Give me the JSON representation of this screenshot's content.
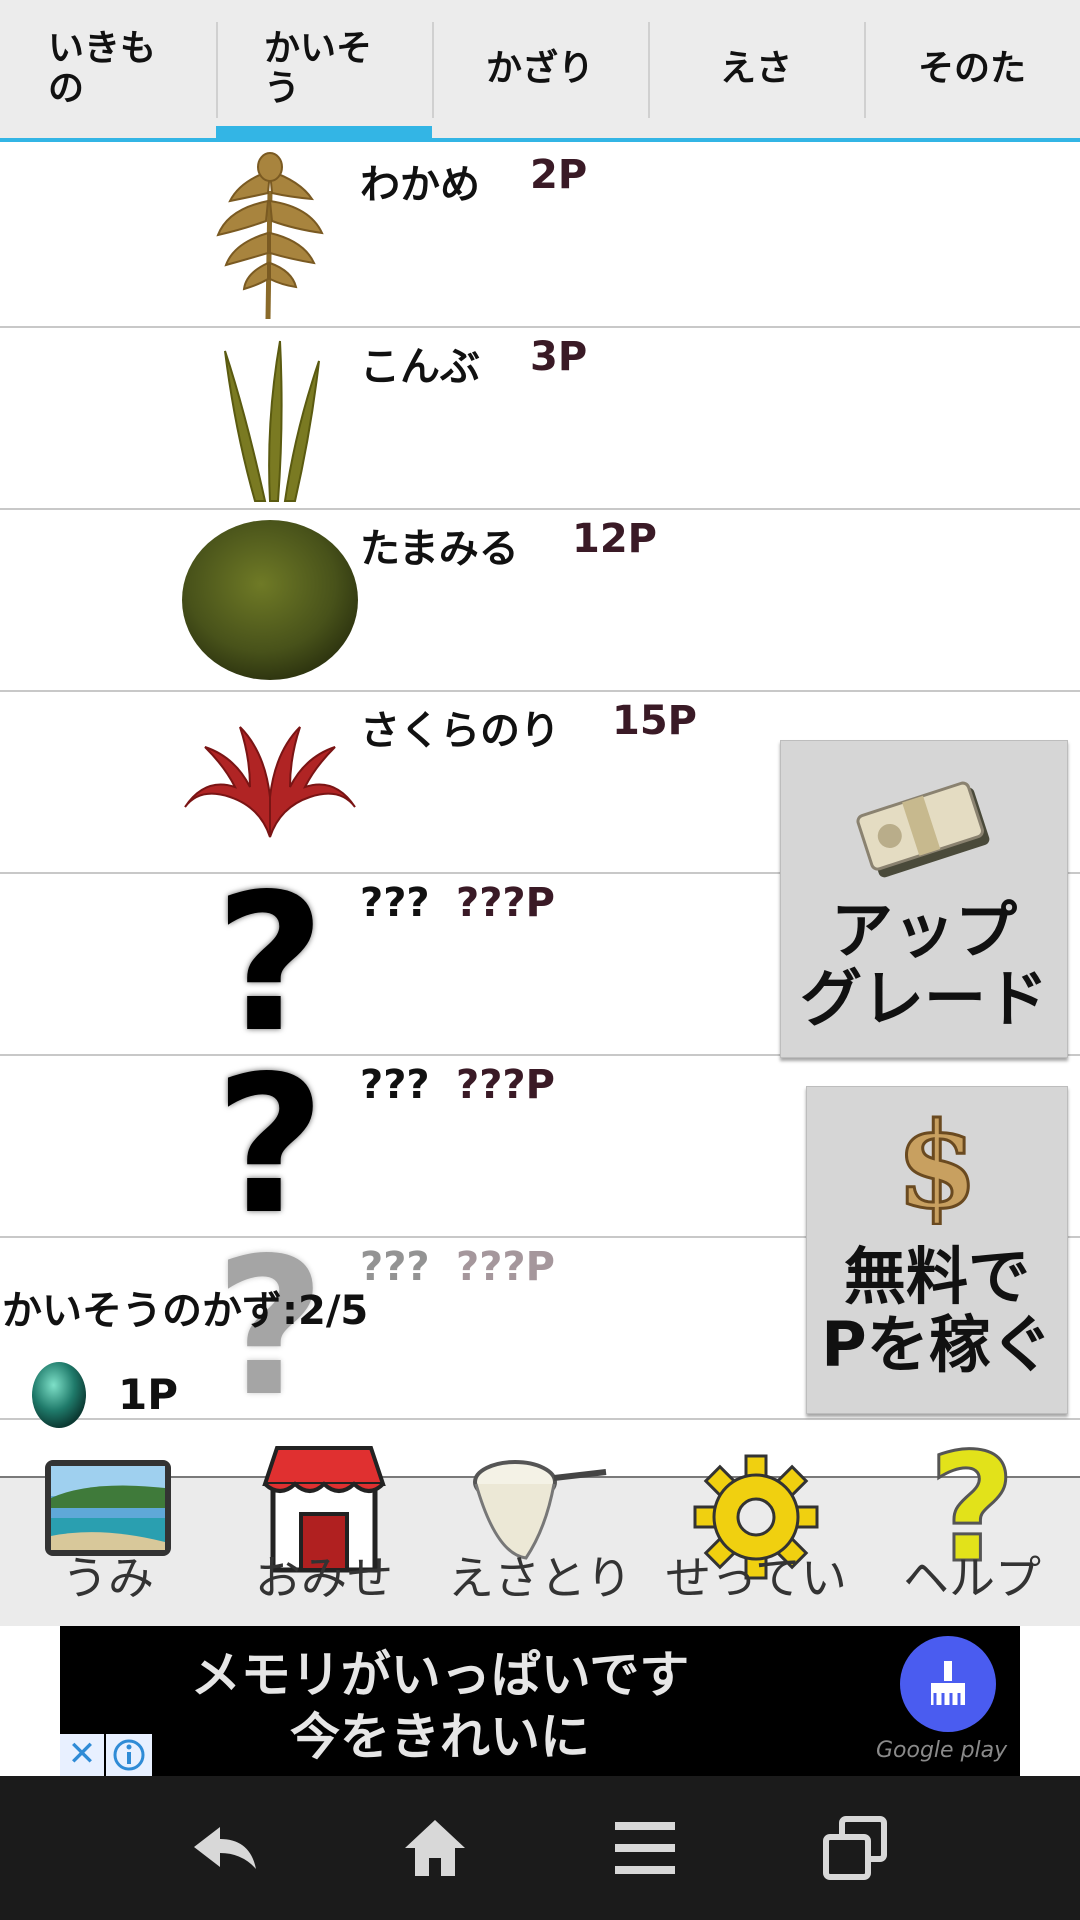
{
  "tabs": [
    {
      "label": "いきもの",
      "active": false
    },
    {
      "label": "かいそう",
      "active": true
    },
    {
      "label": "かざり",
      "active": false
    },
    {
      "label": "えさ",
      "active": false
    },
    {
      "label": "そのた",
      "active": false
    }
  ],
  "items": [
    {
      "name": "わかめ",
      "price": "2P",
      "icon": "wakame-seaweed-icon"
    },
    {
      "name": "こんぶ",
      "price": "3P",
      "icon": "kelp-icon"
    },
    {
      "name": "たまみる",
      "price": "12P",
      "icon": "marimo-ball-icon"
    },
    {
      "name": "さくらのり",
      "price": "15P",
      "icon": "red-seaweed-icon"
    },
    {
      "name": "???",
      "price": "???P",
      "icon": "question-mark-icon"
    },
    {
      "name": "???",
      "price": "???P",
      "icon": "question-mark-icon"
    },
    {
      "name": "???",
      "price": "???P",
      "icon": "question-mark-icon"
    }
  ],
  "upgrade_button": {
    "label": "アップ\nグレード",
    "icon": "money-bundle-icon"
  },
  "earn_button": {
    "label": "無料で\nPを稼ぐ",
    "icon": "dollar-sign-icon"
  },
  "seaweed_count_label": "かいそうのかず:2/5",
  "points": "1P",
  "bottom_nav": [
    {
      "label": "うみ",
      "icon": "sea-photo-icon"
    },
    {
      "label": "おみせ",
      "icon": "shop-icon"
    },
    {
      "label": "えさとり",
      "icon": "net-icon"
    },
    {
      "label": "せってい",
      "icon": "gear-icon"
    },
    {
      "label": "ヘルプ",
      "icon": "help-question-icon"
    }
  ],
  "ad": {
    "line1": "メモリがいっぱいです",
    "line2": "今をきれいに",
    "store": "Google play"
  },
  "colors": {
    "accent": "#33b5e5",
    "price": "#3a1a26",
    "tab_bg": "#ececec",
    "button_bg": "#d6d6d6"
  }
}
